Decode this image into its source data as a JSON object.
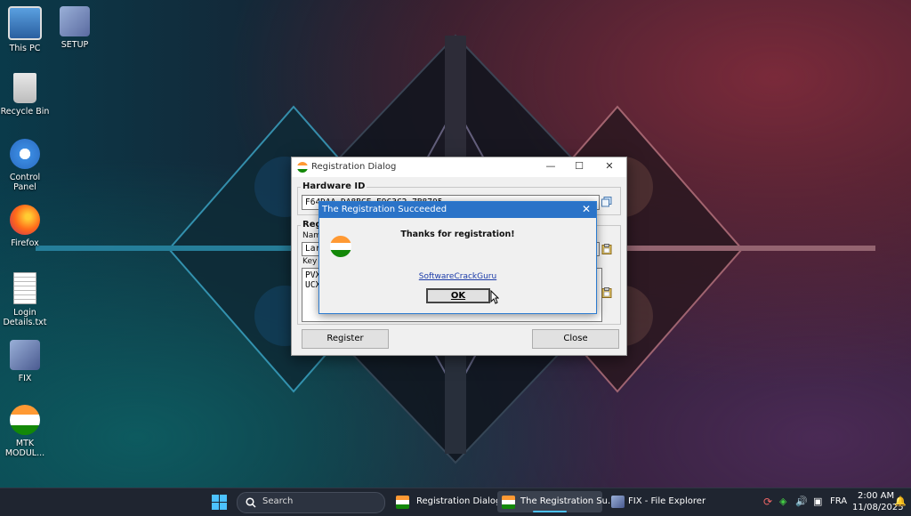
{
  "desktop": {
    "icons": [
      {
        "label": "This PC"
      },
      {
        "label": "SETUP"
      },
      {
        "label": "Recycle Bin"
      },
      {
        "label": "Control Panel"
      },
      {
        "label": "Firefox"
      },
      {
        "label": "Login Details.txt"
      },
      {
        "label": "FIX"
      },
      {
        "label": "MTK MODUL..."
      }
    ]
  },
  "registration_dialog": {
    "title": "Registration Dialog",
    "hardware_id_label": "Hardware ID",
    "hardware_id_value": "F64DAA-DA8BCE-E9C3C2-7B8705",
    "registration_group_label": "Regi",
    "name_label": "Name",
    "name_value": "Larc",
    "key_label": "Key",
    "key_line1": "PVX",
    "key_line2": "UCX",
    "register_button": "Register",
    "close_button": "Close"
  },
  "message_box": {
    "title": "The Registration Succeeded",
    "message": "Thanks for registration!",
    "link": "SoftwareCrackGuru",
    "ok_button": "OK"
  },
  "taskbar": {
    "search_placeholder": "Search",
    "items": [
      {
        "label": "Registration Dialog"
      },
      {
        "label": "The Registration Su..."
      },
      {
        "label": "FIX - File Explorer"
      }
    ],
    "language": "FRA",
    "time": "2:00 AM",
    "date": "11/08/2025"
  },
  "colors": {
    "accent": "#2a73c8",
    "taskbar": "#1f2530",
    "dialog_bg": "#f0f0f0"
  }
}
